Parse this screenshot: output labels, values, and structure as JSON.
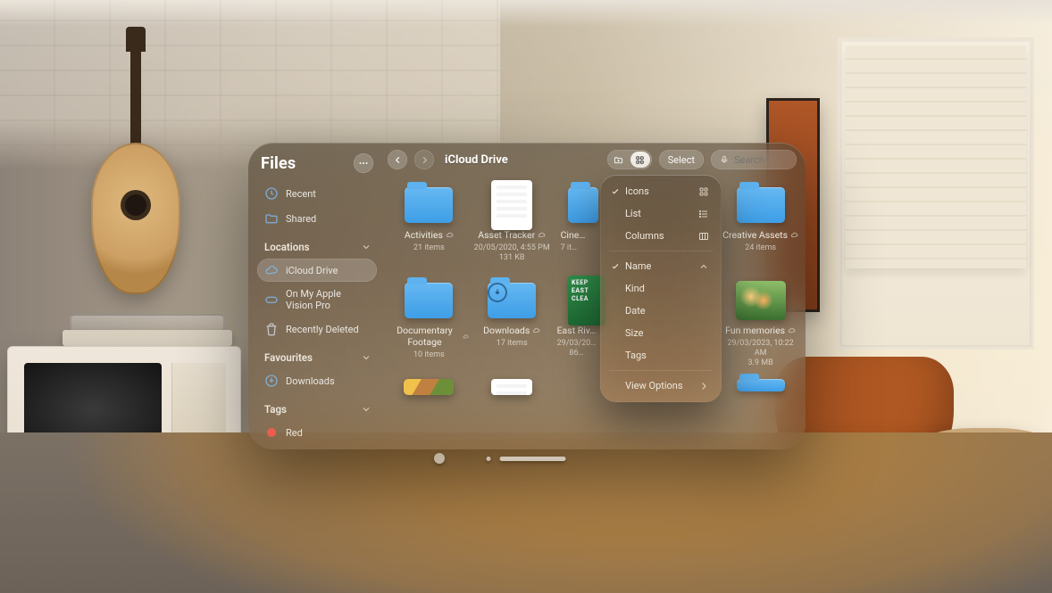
{
  "app": {
    "title": "Files"
  },
  "sidebar": {
    "recent": "Recent",
    "shared": "Shared",
    "locations_header": "Locations",
    "favourites_header": "Favourites",
    "tags_header": "Tags",
    "icloud": "iCloud Drive",
    "visionpro": "On My Apple Vision Pro",
    "recently_deleted": "Recently Deleted",
    "downloads": "Downloads",
    "tag_red": "Red",
    "colors": {
      "tag_red": "#ff5b4f"
    }
  },
  "toolbar": {
    "breadcrumb": "iCloud Drive",
    "select_label": "Select",
    "search_placeholder": "Search"
  },
  "menu": {
    "icons": "Icons",
    "list": "List",
    "columns": "Columns",
    "name": "Name",
    "kind": "Kind",
    "date": "Date",
    "size": "Size",
    "tags_sort": "Tags",
    "view_options": "View Options",
    "selected_view": "Icons",
    "selected_sort": "Name"
  },
  "items": {
    "row1": [
      {
        "name": "Activities",
        "meta": "21 items",
        "type": "folder"
      },
      {
        "name": "Asset Tracker",
        "meta": "20/05/2020, 4:55 PM\n131 KB",
        "type": "doc"
      },
      {
        "name": "Cine…",
        "meta": "7 it…",
        "type": "folder"
      },
      {
        "name": "",
        "meta": "",
        "type": "hidden"
      },
      {
        "name": "Creative Assets",
        "meta": "24 items",
        "type": "folder"
      }
    ],
    "row2": [
      {
        "name": "Documentary Footage",
        "meta": "10 items",
        "type": "folder"
      },
      {
        "name": "Downloads",
        "meta": "17 items",
        "type": "folder-dl"
      },
      {
        "name": "East Riv…",
        "meta": "29/03/20…\n86…",
        "type": "poster",
        "poster_text": "KEEP\nEAST\nCLEA"
      },
      {
        "name": "",
        "meta": "",
        "type": "hidden"
      },
      {
        "name": "Fun memories",
        "meta": "29/03/2023, 10:22 AM\n3.9 MB",
        "type": "photo-b"
      }
    ]
  }
}
